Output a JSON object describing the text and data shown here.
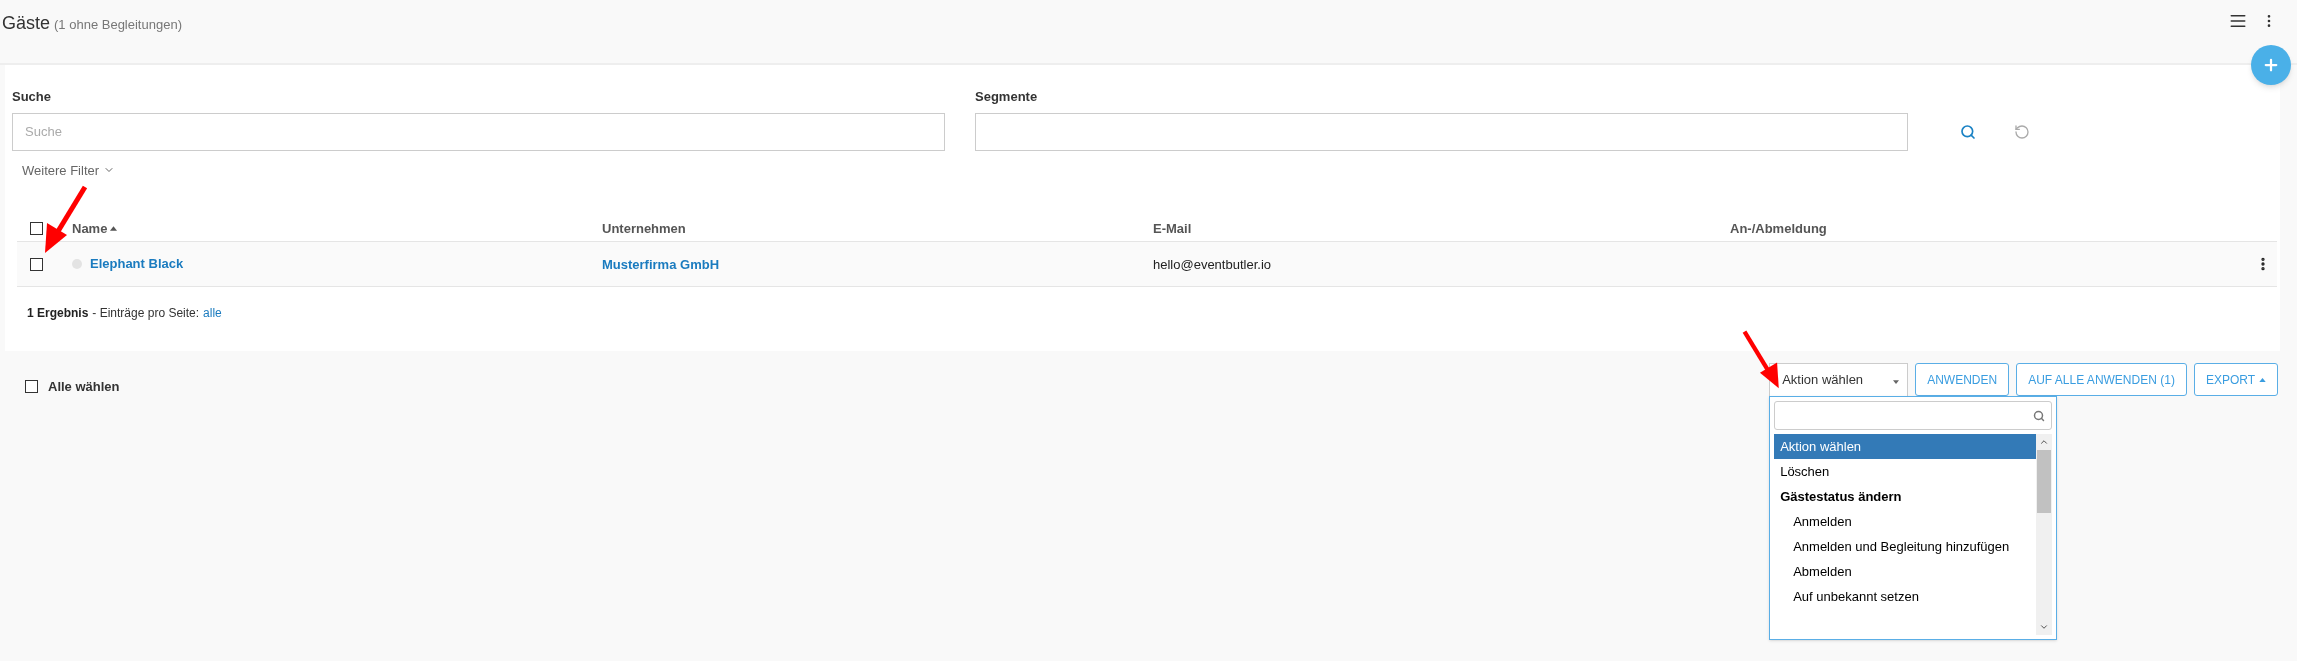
{
  "header": {
    "title": "Gäste",
    "subtitle": "(1 ohne Begleitungen)"
  },
  "filters": [
    {
      "label": "Suche",
      "placeholder": "Suche"
    },
    {
      "label": "Segmente"
    }
  ],
  "more_filters": "Weitere Filter",
  "table": {
    "header_checked": false,
    "columns": [
      {
        "label": "Name",
        "sorted": true
      },
      {
        "label": "Unternehmen",
        "sorted": false
      },
      {
        "label": "E-Mail",
        "sorted": false
      },
      {
        "label": "An-/Abmeldung",
        "sorted": false
      }
    ],
    "rows": [
      {
        "checked": false,
        "color": "#e3e3e3",
        "name": "Elephant Black",
        "company": "Musterfirma GmbH",
        "email": "hello@eventbutler.io"
      }
    ]
  },
  "result": {
    "count": "1 Ergebnis",
    "per_page_label": "- Einträge pro Seite:",
    "per_page_value": "alle"
  },
  "select_all": {
    "label": "Alle wählen",
    "checked": false
  },
  "action_select": {
    "value": "Aktion wählen",
    "options": [
      {
        "kind": "option",
        "label": "Aktion wählen",
        "selected": true
      },
      {
        "kind": "option",
        "label": "Löschen",
        "selected": false
      },
      {
        "kind": "group",
        "label": "Gästestatus ändern",
        "children": [
          {
            "kind": "option",
            "label": "Anmelden",
            "selected": false
          },
          {
            "kind": "option",
            "label": "Anmelden und Begleitung hinzufügen",
            "selected": false
          },
          {
            "kind": "option",
            "label": "Abmelden",
            "selected": false
          },
          {
            "kind": "option",
            "label": "Auf unbekannt setzen",
            "selected": false
          }
        ]
      }
    ]
  },
  "buttons": [
    {
      "kind": "plain",
      "label": "ANWENDEN"
    },
    {
      "kind": "plain",
      "label": "AUF ALLE ANWENDEN (1)"
    },
    {
      "kind": "menu",
      "label": "EXPORT"
    }
  ]
}
